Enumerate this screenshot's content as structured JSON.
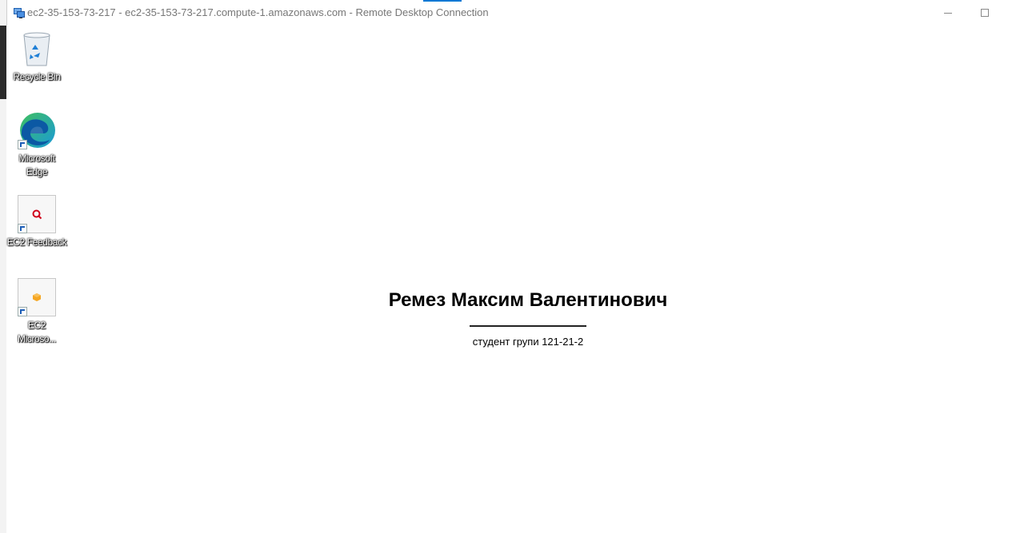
{
  "window": {
    "title": "ec2-35-153-73-217 - ec2-35-153-73-217.compute-1.amazonaws.com - Remote Desktop Connection"
  },
  "desktop_icons": [
    {
      "label": "Recycle Bin",
      "icon": "recycle-bin-icon"
    },
    {
      "label": "Microsoft Edge",
      "icon": "edge-icon"
    },
    {
      "label": "EC2 Feedback",
      "icon": "ec2-feedback-icon"
    },
    {
      "label": "EC2 Microso...",
      "icon": "ec2-microsoft-icon"
    }
  ],
  "wallpaper": {
    "name": "Ремез Максим Валентинович",
    "subtitle": "студент групи 121-21-2"
  },
  "colors": {
    "accent": "#0078d4",
    "edge_blue": "#0c59a4",
    "edge_green": "#3fbf5f",
    "feedback_red": "#d0021b",
    "ec2_orange": "#f5a623"
  }
}
